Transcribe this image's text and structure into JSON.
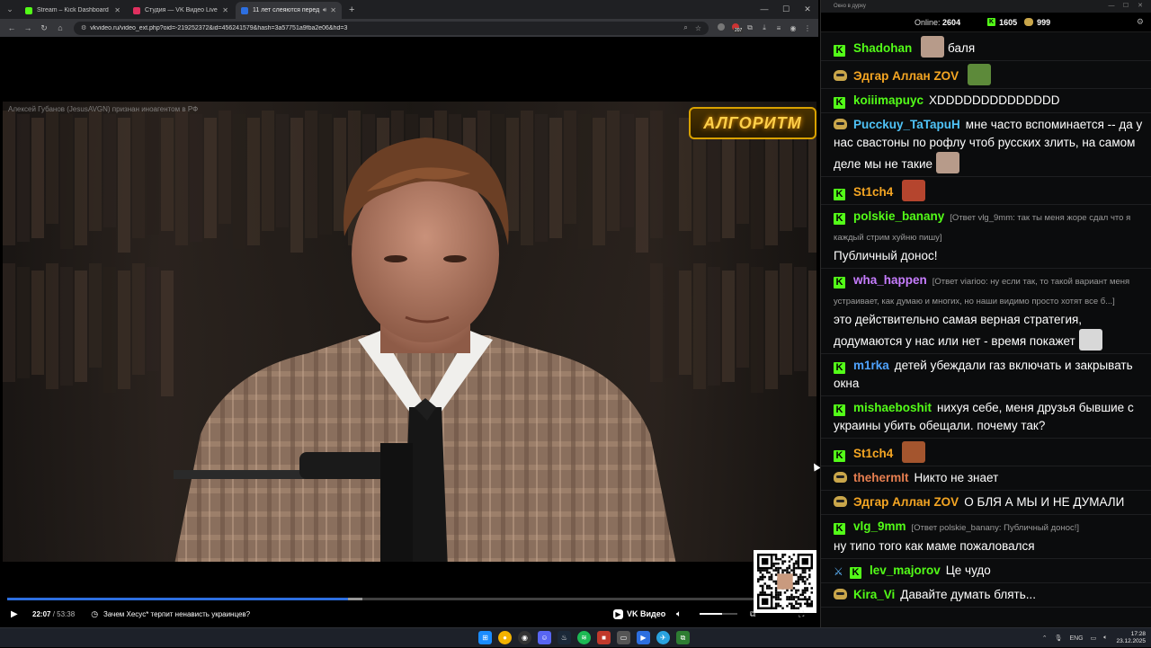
{
  "browser": {
    "tabs": [
      {
        "title": "Stream – Kick Dashboard",
        "color": "#53fc18",
        "active": false
      },
      {
        "title": "Студия — VK Видео Live",
        "color": "#e0305f",
        "active": false
      },
      {
        "title": "11 лет слеяются перед Укра",
        "color": "#2d6fe0",
        "active": true
      }
    ],
    "new_tab": "+",
    "url": "vkvideo.ru/video_ext.php?oid=-219252372&id=456241579&hash=3a57751a9fba2e06&hd=3",
    "ext_badge": "207"
  },
  "video": {
    "watermark": "Алексей Губанов (JesusAVGN) признан иноагентом в РФ",
    "channel_logo": "АЛГОРИТМ",
    "current_time": "22:07",
    "duration": "53:38",
    "episode_title": "Зачем Хесус* терпит ненависть украинцев?",
    "brand": "VK Видео",
    "progress_played": 0.4554,
    "progress_buffered": 0.475,
    "volume": 0.6
  },
  "chat": {
    "window_title": "Окно в дурку",
    "online_label": "Online:",
    "online_count": "2604",
    "kick_count": "1605",
    "vk_count": "999",
    "messages": [
      {
        "platform": "kick",
        "user": "Shadohan",
        "color": "#53fc18",
        "emote_before": "#b79b8a",
        "text": "баля"
      },
      {
        "platform": "vk",
        "user": "Эдгар Аллан ZOV",
        "color": "#f5a623",
        "emote_before": "#5d8a3a",
        "text": ""
      },
      {
        "platform": "kick",
        "user": "koiiimapuyc",
        "color": "#53fc18",
        "text": "XDDDDDDDDDDDDDD"
      },
      {
        "platform": "vk",
        "user": "Pucckuy_TaTapuH",
        "color": "#4fc3f7",
        "text": "мне часто вспоминается -- да у нас свастоны по рофлу чтоб русских злить, на самом деле мы не такие",
        "emote_after": "#b79b8a"
      },
      {
        "platform": "kick",
        "user": "St1ch4",
        "color": "#f5a623",
        "emote_before": "#b5452e",
        "text": ""
      },
      {
        "platform": "kick",
        "user": "polskie_banany",
        "color": "#53fc18",
        "reply": "[Ответ vlg_9mm: так ты меня жоре сдал что я каждый стрим хуйню пишу]",
        "text": "Публичный донос!"
      },
      {
        "platform": "kick",
        "user": "wha_happen",
        "color": "#c77dff",
        "reply": "[Ответ viarioo: ну если так, то такой вариант меня устраивает, как думаю и многих, но наши видимо просто хотят все б...]",
        "text": "это действительно самая верная стратегия, додумаются у нас или нет - время покажет",
        "emote_after": "#d8d8d8"
      },
      {
        "platform": "kick",
        "user": "m1rka",
        "color": "#4fa3ff",
        "text": "детей убеждали газ включать и закрывать окна"
      },
      {
        "platform": "kick",
        "user": "mishaeboshit",
        "color": "#53fc18",
        "text": "нихуя себе, меня друзья бывшие с украины убить обещали. почему так?"
      },
      {
        "platform": "kick",
        "user": "St1ch4",
        "color": "#f5a623",
        "emote_before": "#a4552e",
        "text": ""
      },
      {
        "platform": "vk",
        "user": "thehermIt",
        "color": "#e67e50",
        "text": "Никто не знает"
      },
      {
        "platform": "vk",
        "user": "Эдгар Аллан ZOV",
        "color": "#f5a623",
        "text": "О БЛЯ А МЫ И НЕ ДУМАЛИ"
      },
      {
        "platform": "kick",
        "user": "vlg_9mm",
        "color": "#53fc18",
        "reply": "[Ответ polskie_banany: Публичный донос!]",
        "text": "ну типо того как маме пожаловался"
      },
      {
        "platform": "kick",
        "user": "lev_majorov",
        "color": "#53fc18",
        "sword": true,
        "text": "Це чудо"
      },
      {
        "platform": "vk",
        "user": "Kira_Vi",
        "color": "#53fc18",
        "text": "Давайте думать блять..."
      }
    ]
  },
  "taskbar": {
    "lang": "ENG",
    "time": "17:28",
    "date": "23.12.2025"
  },
  "colors": {
    "kick_green": "#53fc18",
    "vk_blue": "#2d6fe0",
    "logo_gold": "#ffd04a"
  }
}
